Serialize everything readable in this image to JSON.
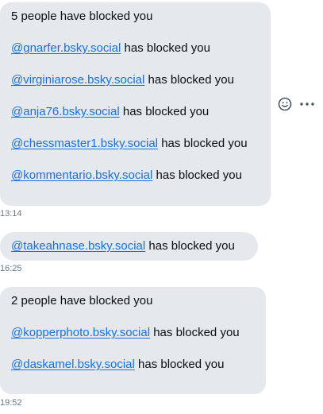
{
  "messages": [
    {
      "header": "5 people have blocked you",
      "entries": [
        {
          "handle": "@gnarfer.bsky.social",
          "suffix": "has blocked you"
        },
        {
          "handle": "@virginiarose.bsky.social",
          "suffix": "has blocked you"
        },
        {
          "handle": "@anja76.bsky.social",
          "suffix": "has blocked you"
        },
        {
          "handle": "@chessmaster1.bsky.social",
          "suffix": "has blocked you"
        },
        {
          "handle": "@kommentario.bsky.social",
          "suffix": "has blocked you"
        }
      ],
      "time": "13:14"
    },
    {
      "entries": [
        {
          "handle": "@takeahnase.bsky.social",
          "suffix": "has blocked you"
        }
      ],
      "time": "16:25"
    },
    {
      "header": "2 people have blocked you",
      "entries": [
        {
          "handle": "@kopperphoto.bsky.social",
          "suffix": "has blocked you"
        },
        {
          "handle": "@daskamel.bsky.social",
          "suffix": "has blocked you"
        }
      ],
      "time": "19:52"
    }
  ],
  "actions": {
    "emoji_icon": "smiley-face-icon",
    "more_icon": "ellipsis-icon"
  },
  "colors": {
    "bubble": "#e5e9ee",
    "link": "#1570e6",
    "text": "#0b0f14",
    "timestamp": "#6b7785",
    "icon": "#4a5563"
  }
}
